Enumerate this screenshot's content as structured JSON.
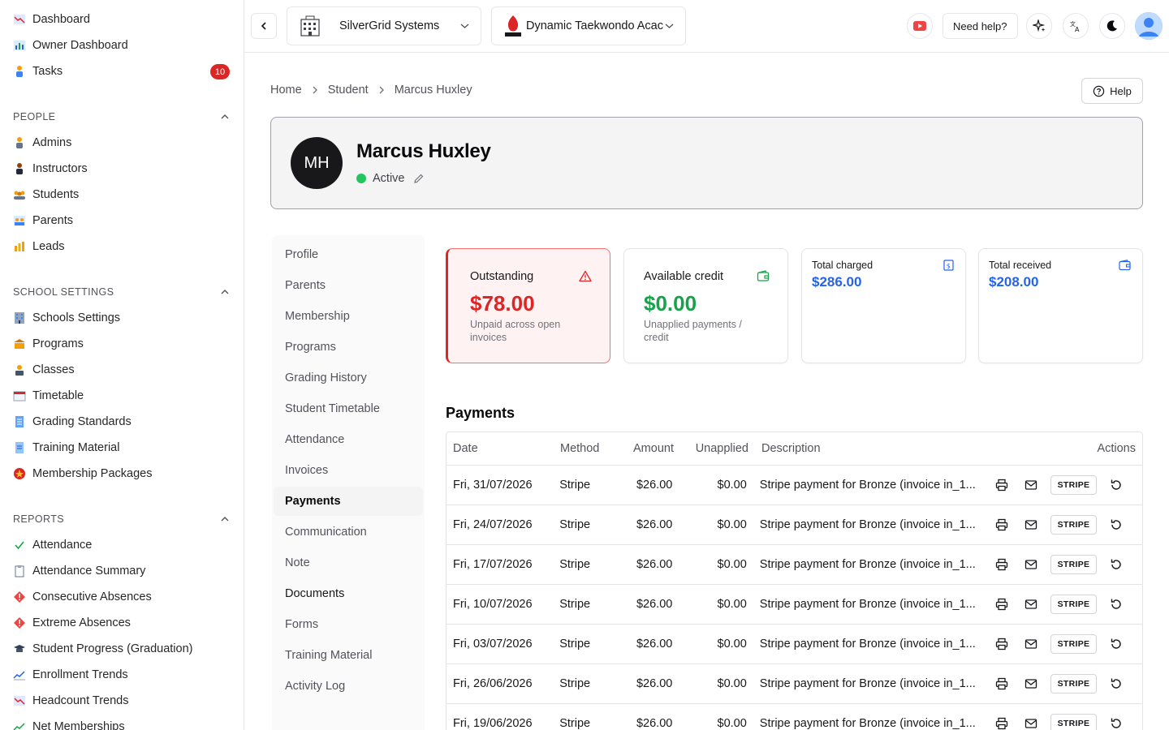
{
  "sidebar": {
    "top_items": [
      {
        "label": "Dashboard",
        "icon": "chart-down-icon"
      },
      {
        "label": "Owner Dashboard",
        "icon": "bar-chart-icon"
      },
      {
        "label": "Tasks",
        "icon": "person-icon",
        "badge": "10"
      }
    ],
    "sections": [
      {
        "title": "PEOPLE",
        "items": [
          {
            "label": "Admins"
          },
          {
            "label": "Instructors"
          },
          {
            "label": "Students"
          },
          {
            "label": "Parents"
          },
          {
            "label": "Leads"
          }
        ]
      },
      {
        "title": "SCHOOL SETTINGS",
        "items": [
          {
            "label": "Schools Settings"
          },
          {
            "label": "Programs"
          },
          {
            "label": "Classes"
          },
          {
            "label": "Timetable"
          },
          {
            "label": "Grading Standards"
          },
          {
            "label": "Training Material"
          },
          {
            "label": "Membership Packages"
          }
        ]
      },
      {
        "title": "REPORTS",
        "items": [
          {
            "label": "Attendance"
          },
          {
            "label": "Attendance Summary"
          },
          {
            "label": "Consecutive Absences"
          },
          {
            "label": "Extreme Absences"
          },
          {
            "label": "Student Progress (Graduation)"
          },
          {
            "label": "Enrollment Trends"
          },
          {
            "label": "Headcount Trends"
          },
          {
            "label": "Net Memberships"
          }
        ]
      }
    ]
  },
  "topbar": {
    "org_select": "SilverGrid Systems",
    "school_select": "Dynamic Taekwondo Acac",
    "need_help": "Need help?"
  },
  "breadcrumb": [
    "Home",
    "Student",
    "Marcus Huxley"
  ],
  "help_label": "Help",
  "profile": {
    "initials": "MH",
    "name": "Marcus Huxley",
    "status": "Active"
  },
  "subnav": [
    {
      "label": "Profile"
    },
    {
      "label": "Parents"
    },
    {
      "label": "Membership"
    },
    {
      "label": "Programs"
    },
    {
      "label": "Grading History"
    },
    {
      "label": "Student Timetable"
    },
    {
      "label": "Attendance"
    },
    {
      "label": "Invoices"
    },
    {
      "label": "Payments",
      "active": true
    },
    {
      "label": "Communication"
    },
    {
      "label": "Note"
    },
    {
      "label": "Documents",
      "dark": true
    },
    {
      "label": "Forms"
    },
    {
      "label": "Training Material"
    },
    {
      "label": "Activity Log"
    }
  ],
  "stats": {
    "outstanding": {
      "title": "Outstanding",
      "value": "$78.00",
      "sub": "Unpaid across open invoices"
    },
    "credit": {
      "title": "Available credit",
      "value": "$0.00",
      "sub": "Unapplied payments / credit"
    },
    "charged": {
      "title": "Total charged",
      "value": "$286.00"
    },
    "received": {
      "title": "Total received",
      "value": "$208.00"
    }
  },
  "payments": {
    "title": "Payments",
    "headers": {
      "date": "Date",
      "method": "Method",
      "amount": "Amount",
      "unapplied": "Unapplied",
      "description": "Description",
      "actions": "Actions"
    },
    "stripe_label": "STRIPE",
    "rows": [
      {
        "date": "Fri, 31/07/2026",
        "method": "Stripe",
        "amount": "$26.00",
        "unapplied": "$0.00",
        "description": "Stripe payment for Bronze (invoice in_1..."
      },
      {
        "date": "Fri, 24/07/2026",
        "method": "Stripe",
        "amount": "$26.00",
        "unapplied": "$0.00",
        "description": "Stripe payment for Bronze (invoice in_1..."
      },
      {
        "date": "Fri, 17/07/2026",
        "method": "Stripe",
        "amount": "$26.00",
        "unapplied": "$0.00",
        "description": "Stripe payment for Bronze (invoice in_1..."
      },
      {
        "date": "Fri, 10/07/2026",
        "method": "Stripe",
        "amount": "$26.00",
        "unapplied": "$0.00",
        "description": "Stripe payment for Bronze (invoice in_1..."
      },
      {
        "date": "Fri, 03/07/2026",
        "method": "Stripe",
        "amount": "$26.00",
        "unapplied": "$0.00",
        "description": "Stripe payment for Bronze (invoice in_1..."
      },
      {
        "date": "Fri, 26/06/2026",
        "method": "Stripe",
        "amount": "$26.00",
        "unapplied": "$0.00",
        "description": "Stripe payment for Bronze (invoice in_1..."
      },
      {
        "date": "Fri, 19/06/2026",
        "method": "Stripe",
        "amount": "$26.00",
        "unapplied": "$0.00",
        "description": "Stripe payment for Bronze (invoice in_1..."
      }
    ]
  },
  "colors": {
    "danger": "#dc2626",
    "success": "#16a34a",
    "accent": "#2563eb"
  }
}
